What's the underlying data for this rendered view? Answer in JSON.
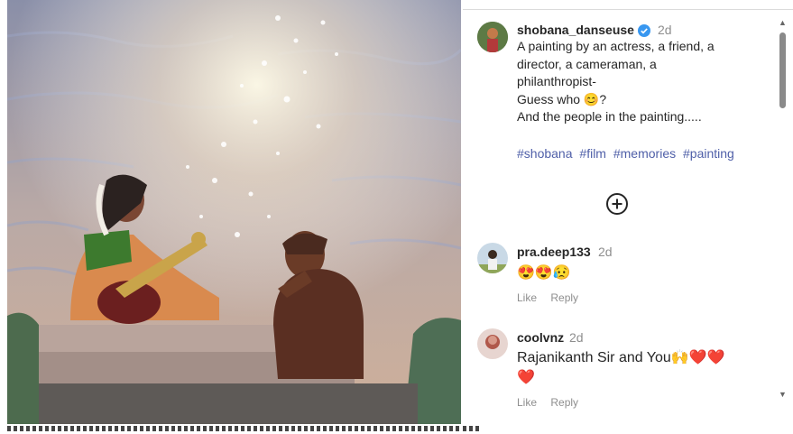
{
  "post": {
    "author": "shobana_danseuse",
    "time": "2d",
    "caption_lines": [
      "A painting by an actress, a friend, a",
      "director, a cameraman, a",
      "philanthropist-",
      "Guess who 😊?",
      "And the people in the painting....."
    ],
    "hashtags": [
      "#shobana",
      "#film",
      "#memories",
      "#painting"
    ]
  },
  "comments": [
    {
      "author": "pra.deep133",
      "time": "2d",
      "text": "😍😍😥",
      "like_label": "Like",
      "reply_label": "Reply"
    },
    {
      "author": "coolvnz",
      "time": "2d",
      "text_line1": "Rajanikanth Sir and You🙌❤️❤️",
      "text_line2": "❤️",
      "like_label": "Like",
      "reply_label": "Reply"
    }
  ],
  "icons": {
    "verified": "verified-badge-icon",
    "more": "plus-circle-icon",
    "scroll_up": "scroll-up-arrow-icon",
    "scroll_down": "scroll-down-arrow-icon"
  },
  "colors": {
    "verified": "#3897f0",
    "hashtag": "#4f5fa8",
    "muted": "#8e8e8e",
    "text": "#262626"
  }
}
